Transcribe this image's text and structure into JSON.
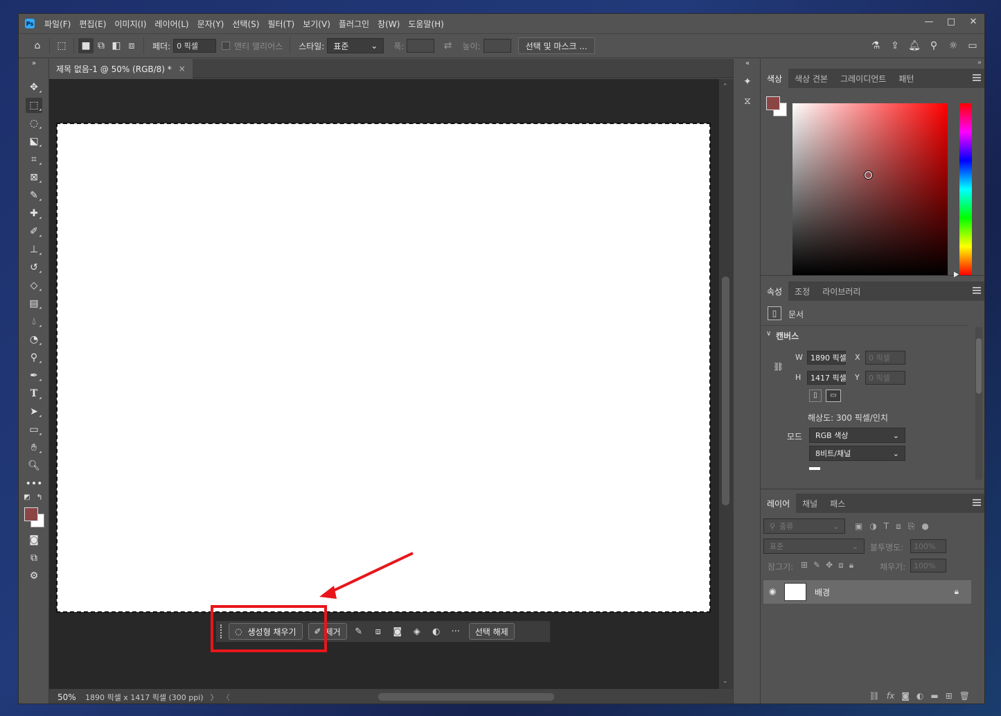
{
  "menubar": {
    "items": [
      "파일(F)",
      "편집(E)",
      "이미지(I)",
      "레이어(L)",
      "문자(Y)",
      "선택(S)",
      "필터(T)",
      "보기(V)",
      "플러그인",
      "창(W)",
      "도움말(H)"
    ],
    "logo_icon": "photoshop-logo-icon",
    "window_controls": [
      "minimize-icon",
      "maximize-icon",
      "close-icon"
    ]
  },
  "optbar": {
    "feather_label": "페더:",
    "feather_value": "0 픽셀",
    "antialias_label": "앤티 앨리어스",
    "style_label": "스타일:",
    "style_value": "표준",
    "width_label": "폭:",
    "height_label": "높이:",
    "select_mask_button": "선택 및 마스크 ..."
  },
  "document": {
    "tab_title": "제목 없음-1 @ 50% (RGB/8) *",
    "tab_close": "×",
    "page_color": "#ffffff"
  },
  "statusbar": {
    "zoom": "50%",
    "info": "1890 픽셀 x 1417 픽셀 (300 ppi)",
    "next": "〉",
    "prev": "〈"
  },
  "taskbar": {
    "generative_fill": "생성형 채우기",
    "remove": "제거",
    "deselect": "선택 해제",
    "more": "···"
  },
  "annotation": {
    "highlight_color": "#e8161b"
  },
  "color_panel": {
    "tabs": [
      "색상",
      "색상 견본",
      "그레이디언트",
      "패턴"
    ],
    "foreground": "#8c4545",
    "background": "#ffffff"
  },
  "properties_panel": {
    "tabs": [
      "속성",
      "조정",
      "라이브러리"
    ],
    "doc_label": "문서",
    "section_title": "캔버스",
    "w_label": "W",
    "w_value": "1890 픽셀",
    "h_label": "H",
    "h_value": "1417 픽셀",
    "x_label": "X",
    "x_value": "0 픽셀",
    "y_label": "Y",
    "y_value": "0 픽셀",
    "resolution": "해상도: 300 픽셀/인치",
    "mode_label": "모드",
    "mode_value": "RGB 색상",
    "bit_value": "8비트/채널"
  },
  "layers_panel": {
    "tabs": [
      "레이어",
      "채널",
      "패스"
    ],
    "filter_placeholder": "종류",
    "blend_mode": "표준",
    "opacity_label": "불투명도:",
    "opacity_value": "100%",
    "lock_label": "잠그기:",
    "fill_label": "채우기:",
    "fill_value": "100%",
    "layer_name": "배경"
  }
}
